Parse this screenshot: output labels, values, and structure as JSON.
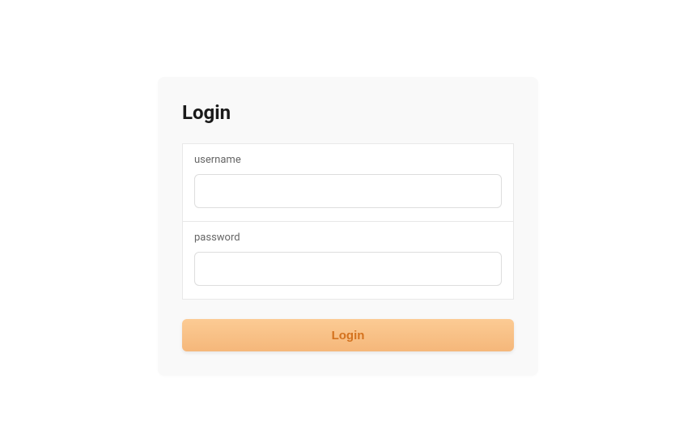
{
  "login": {
    "title": "Login",
    "username_label": "username",
    "username_value": "",
    "password_label": "password",
    "password_value": "",
    "button_label": "Login"
  }
}
